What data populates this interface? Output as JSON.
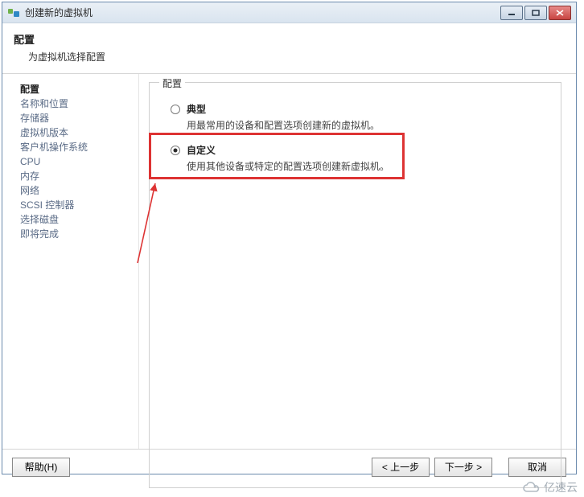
{
  "window": {
    "title": "创建新的虚拟机"
  },
  "header": {
    "title": "配置",
    "subtitle": "为虚拟机选择配置"
  },
  "sidebar": {
    "items": [
      {
        "label": "配置",
        "active": true
      },
      {
        "label": "名称和位置"
      },
      {
        "label": "存储器"
      },
      {
        "label": "虚拟机版本"
      },
      {
        "label": "客户机操作系统"
      },
      {
        "label": "CPU"
      },
      {
        "label": "内存"
      },
      {
        "label": "网络"
      },
      {
        "label": "SCSI 控制器"
      },
      {
        "label": "选择磁盘"
      },
      {
        "label": "即将完成"
      }
    ]
  },
  "fieldset": {
    "legend": "配置"
  },
  "options": {
    "typical": {
      "label": "典型",
      "desc": "用最常用的设备和配置选项创建新的虚拟机。"
    },
    "custom": {
      "label": "自定义",
      "desc": "使用其他设备或特定的配置选项创建新虚拟机。"
    }
  },
  "buttons": {
    "help": "帮助(H)",
    "back": "< 上一步",
    "next": "下一步 >",
    "cancel": "取消"
  },
  "watermark": {
    "text": "亿速云"
  }
}
